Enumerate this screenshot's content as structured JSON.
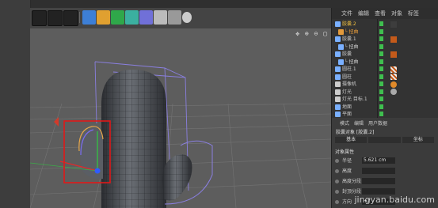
{
  "viewport": {
    "nav_icons": "✥ ⊕ ⊖ ▢"
  },
  "panel": {
    "menu": [
      "文件",
      "编辑",
      "查看",
      "对象",
      "标签"
    ],
    "objects": [
      {
        "name": "胶囊.2",
        "color": "#7ab0ff",
        "selected": true,
        "indent": 0
      },
      {
        "name": "└ 扭曲",
        "color": "#e39a3b",
        "selected": false,
        "indent": 1
      },
      {
        "name": "胶囊.1",
        "color": "#7ab0ff",
        "selected": false,
        "indent": 0
      },
      {
        "name": "└ 扭曲",
        "color": "#7ab0ff",
        "selected": false,
        "indent": 1
      },
      {
        "name": "胶囊",
        "color": "#7ab0ff",
        "selected": false,
        "indent": 0
      },
      {
        "name": "└ 扭曲",
        "color": "#7ab0ff",
        "selected": false,
        "indent": 1
      },
      {
        "name": "圆柱.1",
        "color": "#7ab0ff",
        "selected": false,
        "indent": 0
      },
      {
        "name": "圆柱",
        "color": "#7ab0ff",
        "selected": false,
        "indent": 0
      },
      {
        "name": "摄像机",
        "color": "#cccccc",
        "selected": false,
        "indent": 0
      },
      {
        "name": "灯光",
        "color": "#cccccc",
        "selected": false,
        "indent": 0
      },
      {
        "name": "灯光 目标.1",
        "color": "#cccccc",
        "selected": false,
        "indent": 0
      },
      {
        "name": "地面",
        "color": "#7ab0ff",
        "selected": false,
        "indent": 0
      },
      {
        "name": "平面",
        "color": "#7ab0ff",
        "selected": false,
        "indent": 0
      }
    ],
    "attr_tabs": [
      "模式",
      "编辑",
      "用户数据"
    ],
    "attr_title": "胶囊对象 [胶囊.2]",
    "attr_sub": [
      "基本",
      "",
      "坐标"
    ],
    "section": "对象属性",
    "fields": [
      {
        "label": "半径",
        "value": "5.621 cm"
      },
      {
        "label": "高度",
        "value": ""
      },
      {
        "label": "高度分段",
        "value": ""
      },
      {
        "label": "封顶分段",
        "value": ""
      },
      {
        "label": "方向",
        "value": "+Y"
      }
    ]
  },
  "watermark": "jingyan.baidu.com"
}
